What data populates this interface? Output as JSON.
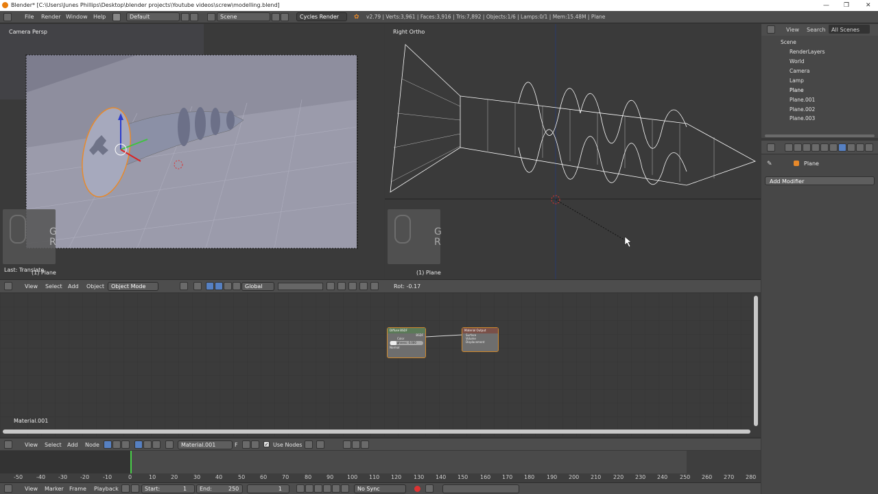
{
  "window": {
    "title": "Blender* [C:\\Users\\Junes Phillips\\Desktop\\blender projects\\Youtube videos\\screw\\modelling.blend]",
    "minimize": "—",
    "maximize": "❐",
    "close": "✕"
  },
  "topbar": {
    "menus": [
      "File",
      "Render",
      "Window",
      "Help"
    ],
    "layout": "Default",
    "scene": "Scene",
    "engine": "Cycles Render",
    "stats": "v2.79 | Verts:3,961 | Faces:3,916 | Tris:7,892 | Objects:1/6 | Lamps:0/1 | Mem:15.48M | Plane"
  },
  "left_view": {
    "label": "Camera Persp",
    "last_op": "Last: Translate",
    "object": "(1) Plane",
    "keys": "G\nR"
  },
  "right_view": {
    "label": "Right Ortho",
    "object": "(1) Plane",
    "keys": "G\nR",
    "rot": "Rot: -0.17"
  },
  "view3d_header": {
    "menus": [
      "View",
      "Select",
      "Add",
      "Object"
    ],
    "mode": "Object Mode",
    "orientation": "Global"
  },
  "node_editor": {
    "material_label": "Material.001",
    "bsdf_title": "Diffuse BSDF",
    "bsdf_out": "BSDF",
    "bsdf_color": "Color",
    "bsdf_rough": "Roughness: 0.000",
    "bsdf_normal": "Normal",
    "out_title": "Material Output",
    "out_surface": "Surface",
    "out_volume": "Volume",
    "out_disp": "Displacement"
  },
  "node_header": {
    "menus": [
      "View",
      "Select",
      "Add",
      "Node"
    ],
    "material": "Material.001",
    "f": "F",
    "use_nodes": "Use Nodes"
  },
  "timeline": {
    "ticks": [
      "-50",
      "-40",
      "-30",
      "-20",
      "-10",
      "0",
      "10",
      "20",
      "30",
      "40",
      "50",
      "60",
      "70",
      "80",
      "90",
      "100",
      "110",
      "120",
      "130",
      "140",
      "150",
      "160",
      "170",
      "180",
      "190",
      "200",
      "210",
      "220",
      "230",
      "240",
      "250",
      "260",
      "270",
      "280"
    ],
    "menus": [
      "View",
      "Marker",
      "Frame",
      "Playback"
    ],
    "start": "Start:",
    "start_val": "1",
    "end": "End:",
    "end_val": "250",
    "current": "1",
    "sync": "No Sync"
  },
  "outliner": {
    "tabs": [
      "View",
      "Search",
      "All Scenes"
    ],
    "items": [
      "Scene",
      "RenderLayers",
      "World",
      "Camera",
      "Lamp",
      "Plane",
      "Plane.001",
      "Plane.002",
      "Plane.003"
    ]
  },
  "properties": {
    "object": "Plane",
    "add_modifier": "Add Modifier"
  },
  "colors": {
    "accent_orange": "#e8892a",
    "select_blue": "#5680c2",
    "wire": "#ffffff"
  }
}
